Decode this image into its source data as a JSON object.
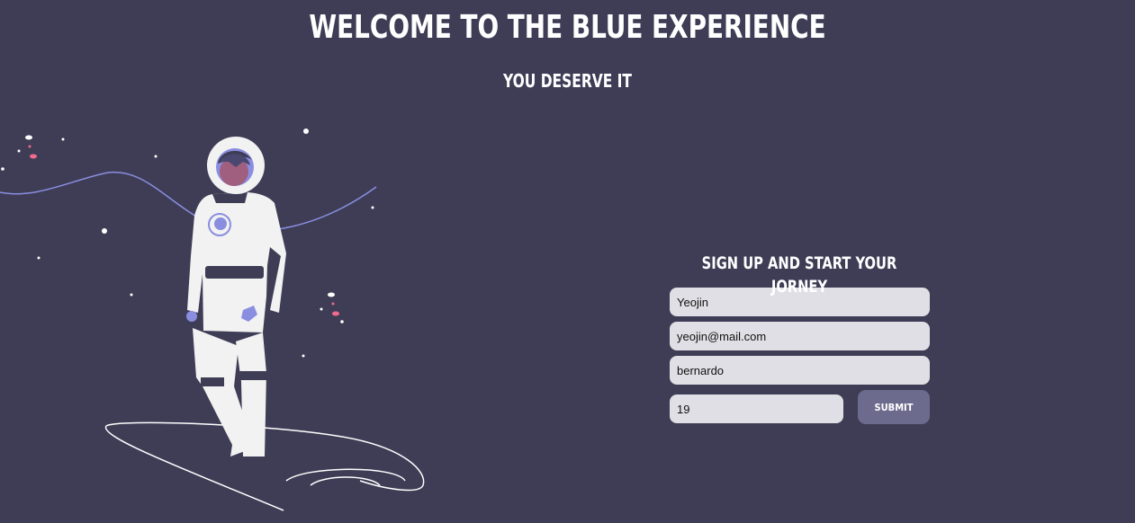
{
  "header": {
    "title": "WELCOME TO THE BLUE EXPERIENCE",
    "subtitle": "YOU DESERVE IT"
  },
  "illustration": {
    "name": "astronaut-illustration"
  },
  "signup": {
    "heading": "SIGN UP AND START YOUR JORNEY",
    "fields": {
      "name": "Yeojin",
      "email": "yeojin@mail.com",
      "password": "bernardo",
      "age": "19"
    },
    "submit_label": "SUBMIT"
  },
  "colors": {
    "background": "#3f3d56",
    "field_bg": "#e0dfe5",
    "button_bg": "#6c6b8e",
    "accent": "#8a8ee0",
    "spark": "#f06c8c"
  }
}
